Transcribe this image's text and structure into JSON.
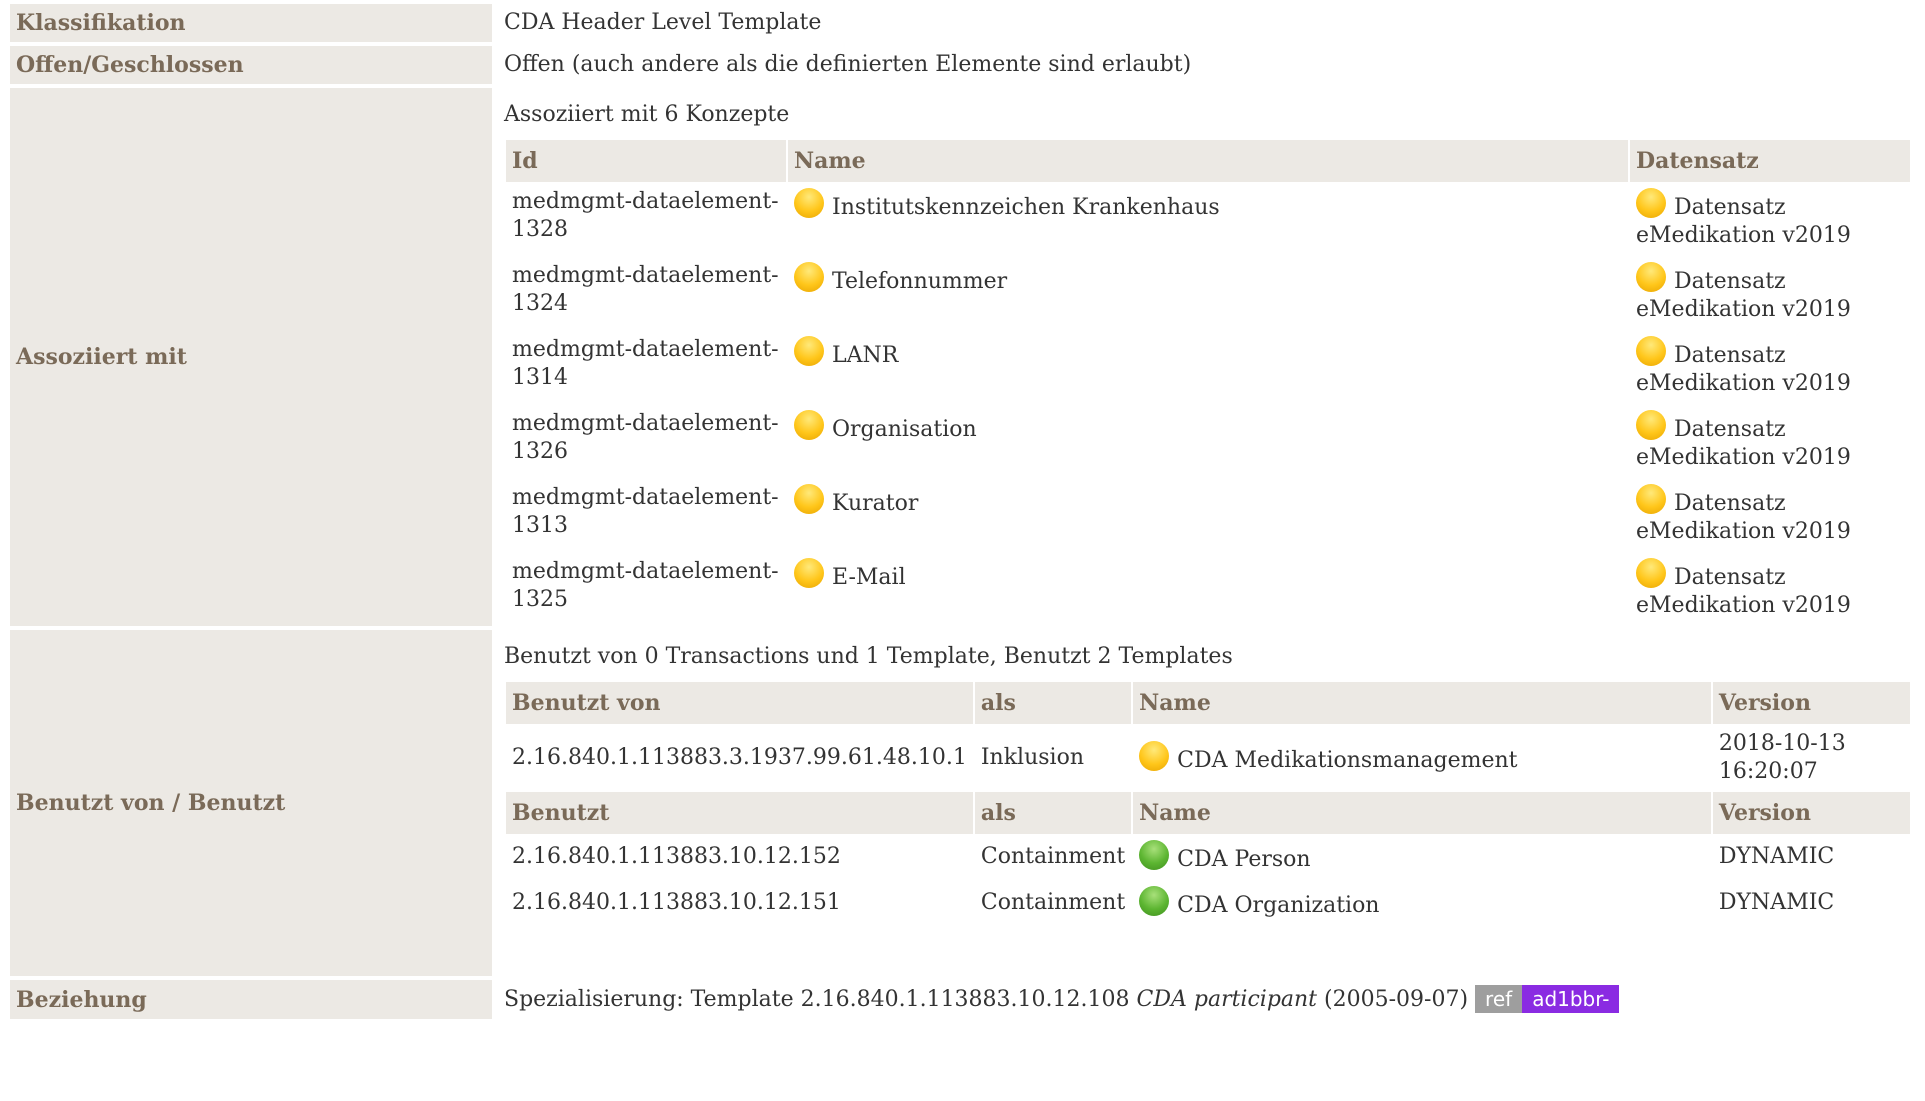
{
  "rows": {
    "klassifikation": {
      "label": "Klassifikation",
      "value": "CDA Header Level Template"
    },
    "offen": {
      "label": "Offen/Geschlossen",
      "value": "Offen (auch andere als die definierten Elemente sind erlaubt)"
    },
    "assoziiert": {
      "label": "Assoziiert mit",
      "caption": "Assoziiert mit 6 Konzepte",
      "headers": {
        "id": "Id",
        "name": "Name",
        "datensatz": "Datensatz"
      },
      "items": [
        {
          "id": "medmgmt-dataelement-1328",
          "name": "Institutskennzeichen Krankenhaus",
          "datensatz": "Datensatz eMedikation v2019",
          "status": "yellow"
        },
        {
          "id": "medmgmt-dataelement-1324",
          "name": "Telefonnummer",
          "datensatz": "Datensatz eMedikation v2019",
          "status": "yellow"
        },
        {
          "id": "medmgmt-dataelement-1314",
          "name": "LANR",
          "datensatz": "Datensatz eMedikation v2019",
          "status": "yellow"
        },
        {
          "id": "medmgmt-dataelement-1326",
          "name": "Organisation",
          "datensatz": "Datensatz eMedikation v2019",
          "status": "yellow"
        },
        {
          "id": "medmgmt-dataelement-1313",
          "name": "Kurator",
          "datensatz": "Datensatz eMedikation v2019",
          "status": "yellow"
        },
        {
          "id": "medmgmt-dataelement-1325",
          "name": "E-Mail",
          "datensatz": "Datensatz eMedikation v2019",
          "status": "yellow"
        }
      ]
    },
    "benutzt": {
      "label": "Benutzt von / Benutzt",
      "caption": "Benutzt von 0 Transactions und 1 Template, Benutzt 2 Templates",
      "headers_von": {
        "col1": "Benutzt von",
        "als": "als",
        "name": "Name",
        "version": "Version"
      },
      "von": [
        {
          "oid": "2.16.840.1.113883.3.1937.99.61.48.10.1",
          "als": "Inklusion",
          "name": "CDA Medikationsmanagement",
          "version": "2018-10-13 16:20:07",
          "status": "yellow"
        }
      ],
      "headers_benutzt": {
        "col1": "Benutzt",
        "als": "als",
        "name": "Name",
        "version": "Version"
      },
      "benutzt": [
        {
          "oid": "2.16.840.1.113883.10.12.152",
          "als": "Containment",
          "name": "CDA Person",
          "version": "DYNAMIC",
          "status": "green"
        },
        {
          "oid": "2.16.840.1.113883.10.12.151",
          "als": "Containment",
          "name": "CDA Organization",
          "version": "DYNAMIC",
          "status": "green"
        }
      ]
    },
    "beziehung": {
      "label": "Beziehung",
      "prefix": "Spezialisierung: Template 2.16.840.1.113883.10.12.108",
      "template_name": "CDA participant",
      "date": "(2005-09-07)",
      "ref": "ref",
      "tag": "ad1bbr-"
    }
  },
  "colors": {
    "header_bg": "#ece9e4",
    "header_text": "#7a6a58",
    "status_yellow": "#ffc61a",
    "status_green": "#5cb531",
    "tag_purple": "#8a2be2",
    "ref_gray": "#9e9e9e"
  }
}
